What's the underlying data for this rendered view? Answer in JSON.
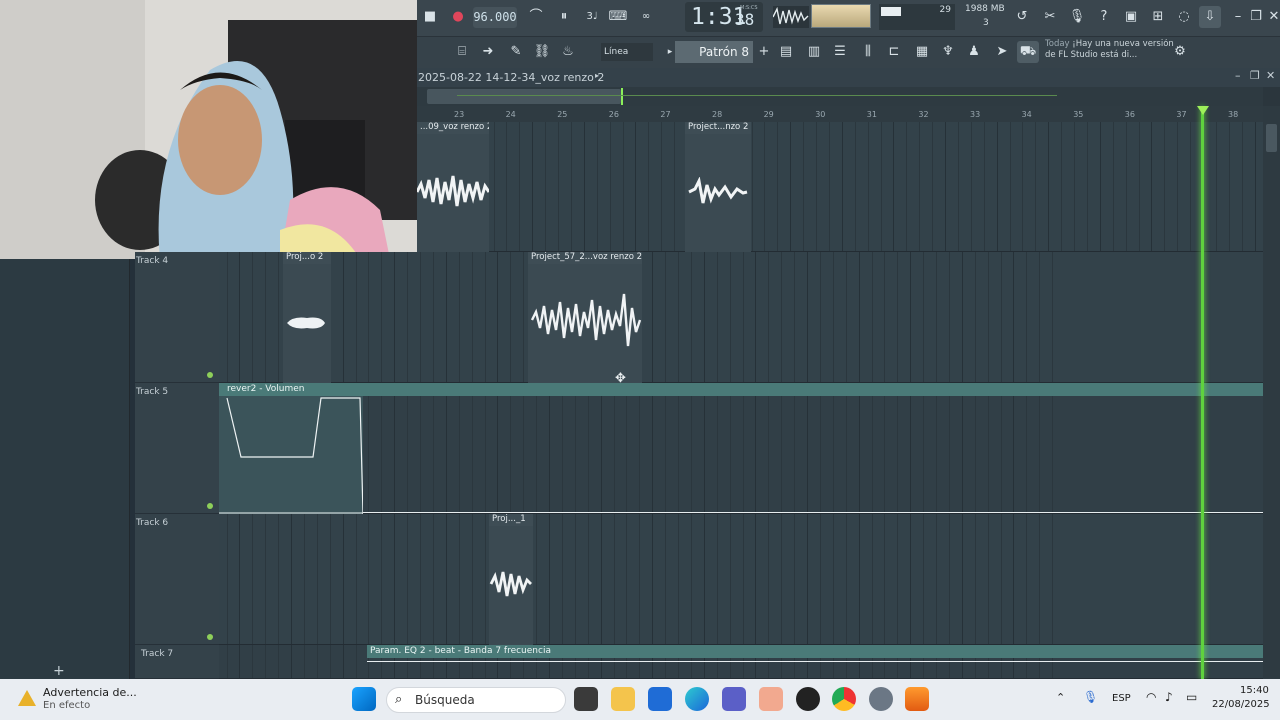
{
  "toolbar": {
    "tempo": "96.000",
    "time_main": "1:31",
    "time_sub": "38",
    "time_mode": "M:S:CS",
    "cpu_value": "29",
    "memory": "1988 MB",
    "poly": "3",
    "snap_mode": "Línea",
    "pattern": "Patrón 8",
    "news_today": "Today",
    "news_text": "¡Hay una nueva versión de FL Studio está di..."
  },
  "playlist": {
    "project_title": "2025-08-22 14-12-34_voz renzo 2",
    "ruler_ticks": [
      "23",
      "24",
      "25",
      "26",
      "27",
      "28",
      "29",
      "30",
      "31",
      "32",
      "33",
      "34",
      "35",
      "36",
      "37",
      "38"
    ]
  },
  "tracks": [
    {
      "label": "Track 4",
      "clips": [
        "Proj...o 2",
        "Project_57_2...voz renzo 2"
      ]
    },
    {
      "label": "Track 5",
      "clips": [
        "rever2 - Volumen"
      ]
    },
    {
      "label": "Track 6",
      "clips": [
        "Proj..._1"
      ]
    },
    {
      "label": "Track 7",
      "clips": [
        "Param. EQ 2 - beat - Banda 7 frecuencia"
      ]
    }
  ],
  "top_clips": [
    "...09_voz renzo 2",
    "Project...nzo 2"
  ],
  "left_panel": {
    "add_button": "+"
  },
  "taskbar": {
    "warning_title": "Advertencia de...",
    "warning_sub": "En efecto",
    "search_placeholder": "Búsqueda",
    "language": "ESP",
    "clock_time": "15:40",
    "clock_date": "22/08/2025"
  },
  "colors": {
    "playhead": "#5fd23e",
    "automation": "#4a7a78",
    "lane": "#33424a"
  }
}
